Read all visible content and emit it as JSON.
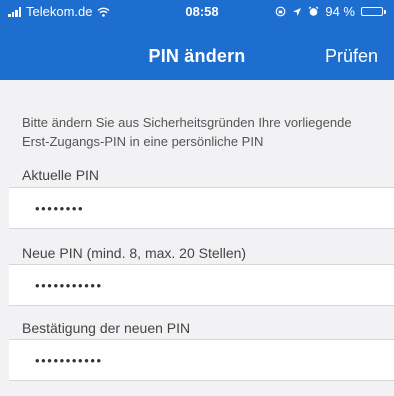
{
  "status_bar": {
    "carrier": "Telekom.de",
    "time": "08:58",
    "battery": "94 %",
    "battery_level": 0.94,
    "icons": [
      "signal-icon",
      "wifi-icon",
      "lock-rotation-icon",
      "location-icon",
      "alarm-icon",
      "battery-icon"
    ]
  },
  "nav": {
    "title": "PIN ändern",
    "action_label": "Prüfen"
  },
  "colors": {
    "header_bg": "#1d6ecf",
    "page_bg": "#f2f2f4",
    "field_bg": "#ffffff"
  },
  "intro_text": "Bitte ändern Sie aus Sicherheitsgründen Ihre vorliegende Erst-Zugangs-PIN in eine persönliche PIN",
  "fields": [
    {
      "label": "Aktuelle PIN",
      "value": "••••••••"
    },
    {
      "label": "Neue PIN (mind. 8, max. 20 Stellen)",
      "value": "•••••••••••"
    },
    {
      "label": "Bestätigung der neuen PIN",
      "value": "•••••••••••"
    }
  ]
}
